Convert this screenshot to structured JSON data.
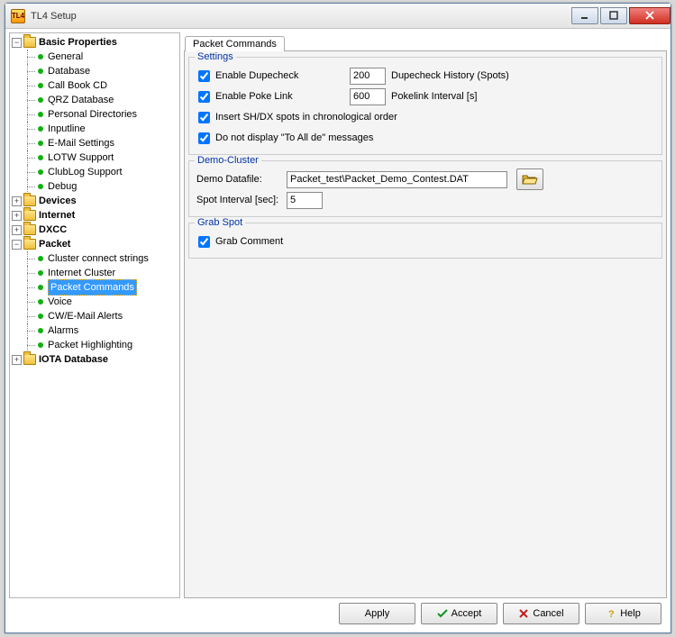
{
  "window": {
    "title": "TL4 Setup",
    "app_icon_text": "TL4"
  },
  "tree": {
    "basic_properties": "Basic Properties",
    "general": "General",
    "database": "Database",
    "call_book_cd": "Call Book CD",
    "qrz_database": "QRZ Database",
    "personal_directories": "Personal Directories",
    "inputline": "Inputline",
    "email_settings": "E-Mail Settings",
    "lotw_support": "LOTW Support",
    "clublog_support": "ClubLog Support",
    "debug": "Debug",
    "devices": "Devices",
    "internet": "Internet",
    "dxcc": "DXCC",
    "packet": "Packet",
    "cluster_connect_strings": "Cluster connect strings",
    "internet_cluster": "Internet Cluster",
    "packet_commands": "Packet Commands",
    "voice": "Voice",
    "cw_email_alerts": "CW/E-Mail Alerts",
    "alarms": "Alarms",
    "packet_highlighting": "Packet Highlighting",
    "iota_database": "IOTA Database"
  },
  "tab": {
    "label": "Packet Commands"
  },
  "settings": {
    "legend": "Settings",
    "enable_dupecheck": "Enable Dupecheck",
    "dupecheck_value": "200",
    "dupecheck_after": "Dupecheck History (Spots)",
    "enable_pokelink": "Enable Poke Link",
    "pokelink_value": "600",
    "pokelink_after": "Pokelink Interval [s]",
    "insert_shdx": "Insert SH/DX spots in chronological order",
    "do_not_display": "Do not display \"To All de\" messages"
  },
  "democluster": {
    "legend": "Demo-Cluster",
    "datafile_label": "Demo Datafile:",
    "datafile_value": "Packet_test\\Packet_Demo_Contest.DAT",
    "spot_interval_label": "Spot Interval [sec]:",
    "spot_interval_value": "5"
  },
  "grabspot": {
    "legend": "Grab Spot",
    "grab_comment": "Grab Comment"
  },
  "buttons": {
    "apply": "Apply",
    "accept": "Accept",
    "cancel": "Cancel",
    "help": "Help"
  }
}
